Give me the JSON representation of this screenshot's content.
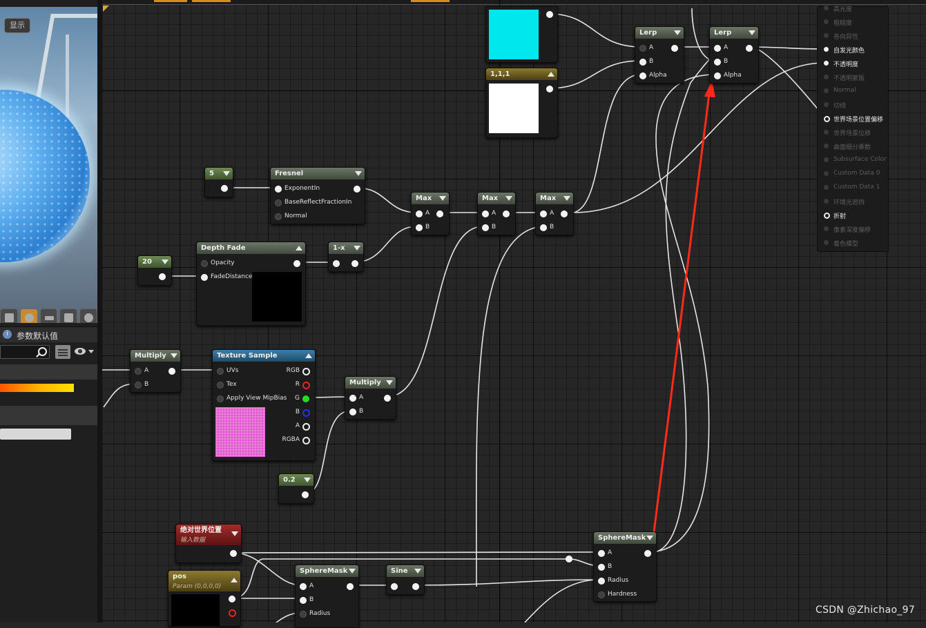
{
  "left_panel": {
    "show_button": "显示",
    "params_title": "参数默认值",
    "params_icon_label": "i",
    "viewport_buttons": [
      "cylinder-preview",
      "sphere-preview",
      "plane-preview",
      "cube-preview",
      "mesh-preview"
    ]
  },
  "nodes": {
    "lerp1": {
      "title": "Lerp",
      "pins": [
        "A",
        "B",
        "Alpha"
      ]
    },
    "lerp2": {
      "title": "Lerp",
      "pins": [
        "A",
        "B",
        "Alpha"
      ]
    },
    "const_111": {
      "title": "1,1,1"
    },
    "const_5": {
      "title": "5"
    },
    "fresnel": {
      "title": "Fresnel",
      "pins": [
        "ExponentIn",
        "BaseReflectFractionIn",
        "Normal"
      ]
    },
    "max1": {
      "title": "Max",
      "pins": [
        "A",
        "B"
      ]
    },
    "max2": {
      "title": "Max",
      "pins": [
        "A",
        "B"
      ]
    },
    "max3": {
      "title": "Max",
      "pins": [
        "A",
        "B"
      ]
    },
    "const_20": {
      "title": "20"
    },
    "depth_fade": {
      "title": "Depth Fade",
      "pins": [
        "Opacity",
        "FadeDistance"
      ]
    },
    "one_minus": {
      "title": "1-x"
    },
    "multiply1": {
      "title": "Multiply",
      "pins": [
        "A",
        "B"
      ]
    },
    "texture_sample": {
      "title": "Texture Sample",
      "inputs": [
        "UVs",
        "Tex",
        "Apply View MipBias"
      ],
      "outputs": [
        "RGB",
        "R",
        "G",
        "B",
        "A",
        "RGBA"
      ]
    },
    "multiply2": {
      "title": "Multiply",
      "pins": [
        "A",
        "B"
      ]
    },
    "const_02": {
      "title": "0.2"
    },
    "abs_world_pos": {
      "title": "绝对世界位置",
      "subtitle": "输入数据"
    },
    "pos": {
      "title": "pos",
      "subtitle": "Param (0,0,0,0)"
    },
    "spheremask_small": {
      "title": "SphereMask",
      "pins": [
        "A",
        "B",
        "Radius"
      ]
    },
    "sine": {
      "title": "Sine"
    },
    "spheremask_big": {
      "title": "SphereMask",
      "pins": [
        "A",
        "B",
        "Radius",
        "Hardness"
      ]
    }
  },
  "result_pins": [
    {
      "label": "高光度",
      "state": "off"
    },
    {
      "label": "粗糙度",
      "state": "off"
    },
    {
      "label": "各向异性",
      "state": "off"
    },
    {
      "label": "自发光颜色",
      "state": "on"
    },
    {
      "label": "不透明度",
      "state": "on"
    },
    {
      "label": "不透明蒙版",
      "state": "off"
    },
    {
      "label": "Normal",
      "state": "off"
    },
    {
      "label": "切线",
      "state": "off"
    },
    {
      "label": "世界场景位置偏移",
      "state": "ring"
    },
    {
      "label": "世界场景位移",
      "state": "off"
    },
    {
      "label": "曲面细分乘数",
      "state": "off"
    },
    {
      "label": "Subsurface Color",
      "state": "off"
    },
    {
      "label": "Custom Data 0",
      "state": "off"
    },
    {
      "label": "Custom Data 1",
      "state": "off"
    },
    {
      "label": "环境光遮挡",
      "state": "off"
    },
    {
      "label": "折射",
      "state": "ring"
    },
    {
      "label": "像素深度偏移",
      "state": "off"
    },
    {
      "label": "着色模型",
      "state": "off"
    }
  ],
  "colors": {
    "cyan_preview": "#00e8ee",
    "white_preview": "#ffffff",
    "pink_preview": "#e060d0",
    "annotation_arrow": "#ff2a1a",
    "pin_g": "#22dd22",
    "pin_r": "#ee2222",
    "pin_b": "#2233ee"
  },
  "watermark": "CSDN @Zhichao_97"
}
